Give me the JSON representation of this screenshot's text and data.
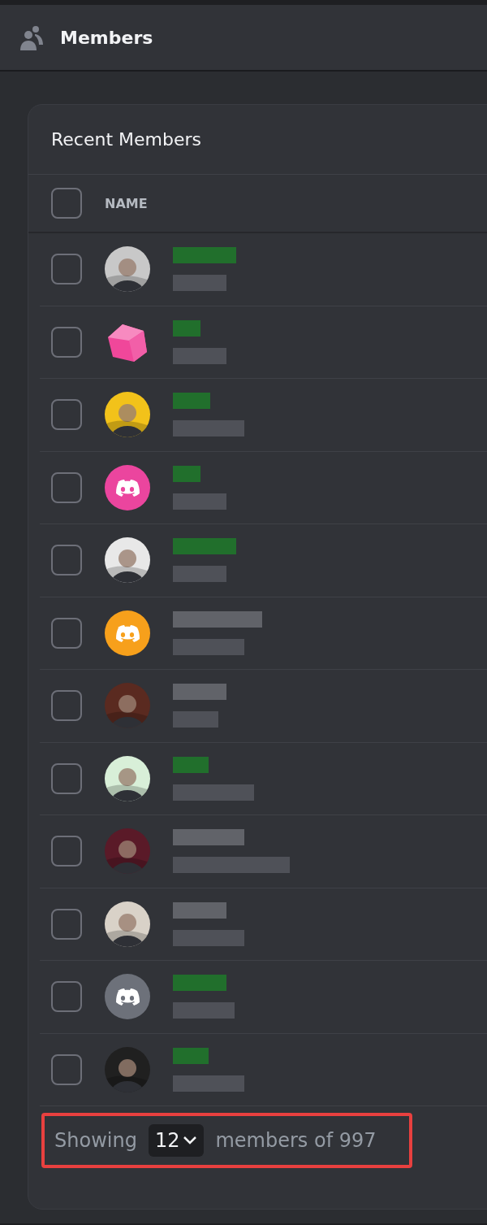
{
  "header": {
    "title": "Members"
  },
  "card": {
    "title": "Recent Members",
    "columns": [
      {
        "label": "NAME"
      }
    ],
    "select_all": {
      "checked": false
    }
  },
  "rows": [
    {
      "checked": false,
      "color": "#1f7a2a"
    },
    {
      "checked": false,
      "avatar": {
        "kind": "cube",
        "color": "#f0479a"
      },
      "color": "#1f7a2a"
    },
    {
      "checked": false,
      "color": "#1f7a2a"
    },
    {
      "checked": false,
      "avatar": {
        "kind": "discord",
        "color": "#eb459e"
      },
      "color": "#1f7a2a"
    },
    {
      "checked": false,
      "color": "#1f7a2a"
    },
    {
      "checked": false,
      "avatar": {
        "kind": "discord",
        "color": "#f7a01b"
      },
      "color": "#6a6c72"
    },
    {
      "checked": false,
      "color": "#6a6c72"
    },
    {
      "checked": false,
      "color": "#1f7a2a"
    },
    {
      "checked": false,
      "color": "#6a6c72"
    },
    {
      "checked": false,
      "color": "#6a6c72"
    },
    {
      "checked": false,
      "avatar": {
        "kind": "discord",
        "color": "#6d717a"
      },
      "color": "#1f7a2a"
    },
    {
      "checked": false,
      "color": "#1f7a2a"
    }
  ],
  "footer": {
    "highlighted": true,
    "prefix": "Showing",
    "page_size": "12",
    "suffix": "members of 997"
  }
}
